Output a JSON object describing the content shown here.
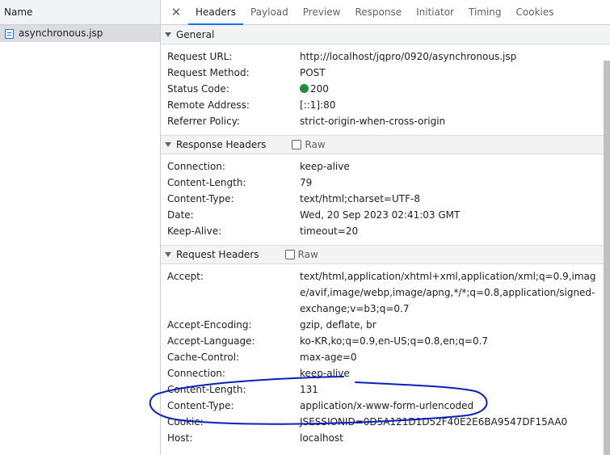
{
  "request_list": {
    "header": "Name",
    "items": [
      {
        "name": "asynchronous.jsp"
      }
    ]
  },
  "tabs": [
    "Headers",
    "Payload",
    "Preview",
    "Response",
    "Initiator",
    "Timing",
    "Cookies"
  ],
  "general": {
    "title": "General",
    "request_url_label": "Request URL:",
    "request_url": "http://localhost/jqpro/0920/asynchronous.jsp",
    "request_method_label": "Request Method:",
    "request_method": "POST",
    "status_code_label": "Status Code:",
    "status_code": "200",
    "remote_address_label": "Remote Address:",
    "remote_address": "[::1]:80",
    "referrer_policy_label": "Referrer Policy:",
    "referrer_policy": "strict-origin-when-cross-origin"
  },
  "response_headers": {
    "title": "Response Headers",
    "raw_label": "Raw",
    "rows": [
      {
        "key": "Connection:",
        "value": "keep-alive"
      },
      {
        "key": "Content-Length:",
        "value": "79"
      },
      {
        "key": "Content-Type:",
        "value": "text/html;charset=UTF-8"
      },
      {
        "key": "Date:",
        "value": "Wed, 20 Sep 2023 02:41:03 GMT"
      },
      {
        "key": "Keep-Alive:",
        "value": "timeout=20"
      }
    ]
  },
  "request_headers": {
    "title": "Request Headers",
    "raw_label": "Raw",
    "rows": [
      {
        "key": "Accept:",
        "value": "text/html,application/xhtml+xml,application/xml;q=0.9,image/avif,image/webp,image/apng,*/*;q=0.8,application/signed-exchange;v=b3;q=0.7"
      },
      {
        "key": "Accept-Encoding:",
        "value": "gzip, deflate, br"
      },
      {
        "key": "Accept-Language:",
        "value": "ko-KR,ko;q=0.9,en-US;q=0.8,en;q=0.7"
      },
      {
        "key": "Cache-Control:",
        "value": "max-age=0"
      },
      {
        "key": "Connection:",
        "value": "keep-alive"
      },
      {
        "key": "Content-Length:",
        "value": "131"
      },
      {
        "key": "Content-Type:",
        "value": "application/x-www-form-urlencoded"
      },
      {
        "key": "Cookie:",
        "value": "JSESSIONID=0D5A121D1D52F40E2E6BA9547DF15AA0"
      },
      {
        "key": "Host:",
        "value": "localhost"
      }
    ]
  },
  "colors": {
    "accent": "#1a73e8",
    "status_ok": "#1e8e3e",
    "annotation": "#0a1fbf"
  }
}
